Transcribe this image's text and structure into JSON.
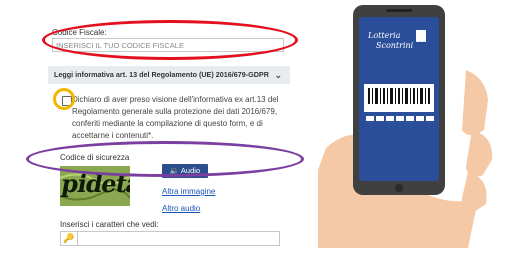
{
  "form": {
    "codice_fiscale_label": "Codice Fiscale:",
    "codice_fiscale_placeholder": "INSERISCI IL TUO CODICE FISCALE",
    "privacy_accordion": "Leggi informativa art. 13 del Regolamento (UE) 2016/679-GDPR",
    "consent_text": "Dichiaro di aver preso visione dell'informativa ex art.13 del Regolamento generale sulla protezione dei dati 2016/679, conferiti mediante la compilazione di questo form, e di accettarne i contenuti",
    "consent_required_mark": "*.",
    "security_code_label": "Codice di sicurezza",
    "captcha_text": "pidetata",
    "audio_button": "Audio",
    "other_image_link": "Altra immagine",
    "other_audio_link": "Altro audio",
    "enter_chars_label": "Inserisci i caratteri che vedi:"
  },
  "phone": {
    "brand_line1": "Lotteria",
    "brand_line2": "Scontrini",
    "barcode_label": "barcode"
  },
  "colors": {
    "red_highlight": "#e3101f",
    "yellow_highlight": "#f2b800",
    "purple_highlight": "#7a3fa0",
    "audio_button_bg": "#2b4e8c",
    "phone_screen": "#2a4e9a"
  },
  "icons": {
    "accordion": "chevron-down-icon",
    "audio": "speaker-icon",
    "key": "key-icon"
  }
}
